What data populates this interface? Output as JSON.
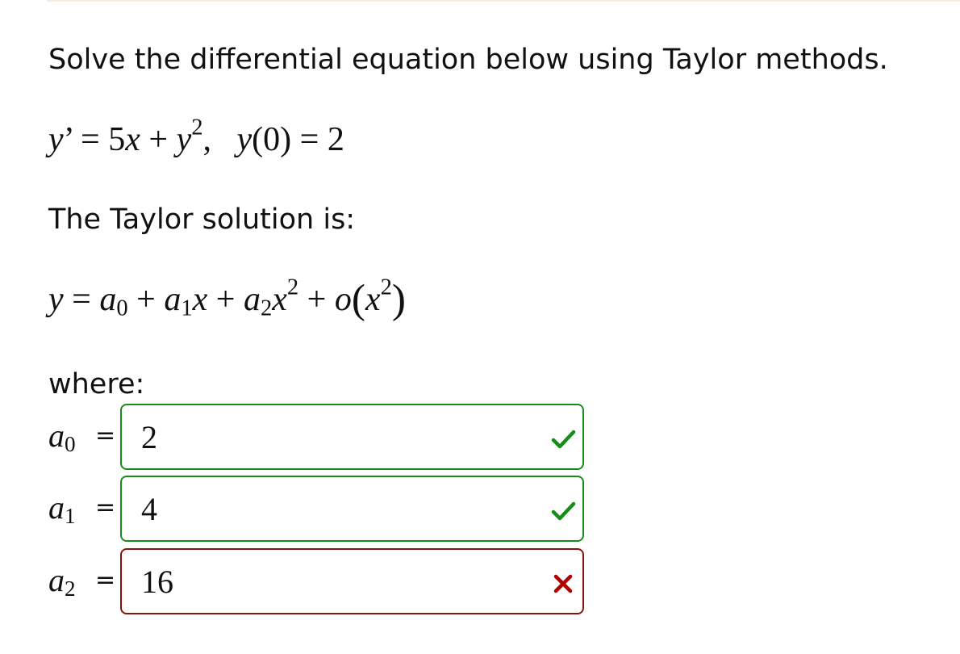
{
  "question": {
    "prompt": "Solve the differential equation below using Taylor methods.",
    "equation": {
      "lhs": "y",
      "prime": "’",
      "equals": "=",
      "coef_x": "5",
      "var_x": "x",
      "plus": "+",
      "var_y": "y",
      "exp": "2",
      "comma": ",",
      "ic_func": "y",
      "ic_open": "(",
      "ic_arg": "0",
      "ic_close": ")",
      "ic_equals": "=",
      "ic_value": "2"
    },
    "solution_intro": "The Taylor solution is:",
    "series": {
      "lhs": "y",
      "equals": "=",
      "a": "a",
      "sub0": "0",
      "plus1": "+",
      "sub1": "1",
      "x1": "x",
      "plus2": "+",
      "sub2": "2",
      "x2": "x",
      "exp2": "2",
      "plus3": "+",
      "little_o": "o",
      "open": "(",
      "x3": "x",
      "exp3": "2",
      "close": ")"
    },
    "where_label": "where:"
  },
  "answers": [
    {
      "symbol": "a",
      "subscript": "0",
      "equals": "=",
      "value": "2",
      "status": "correct",
      "status_icon": "check-icon",
      "border_color": "#188c18",
      "icon_color": "#188c18"
    },
    {
      "symbol": "a",
      "subscript": "1",
      "equals": "=",
      "value": "4",
      "status": "correct",
      "status_icon": "check-icon",
      "border_color": "#188c18",
      "icon_color": "#188c18"
    },
    {
      "symbol": "a",
      "subscript": "2",
      "equals": "=",
      "value": "16",
      "status": "incorrect",
      "status_icon": "x-mark-icon",
      "border_color": "#8b1111",
      "icon_color": "#b00000"
    }
  ]
}
